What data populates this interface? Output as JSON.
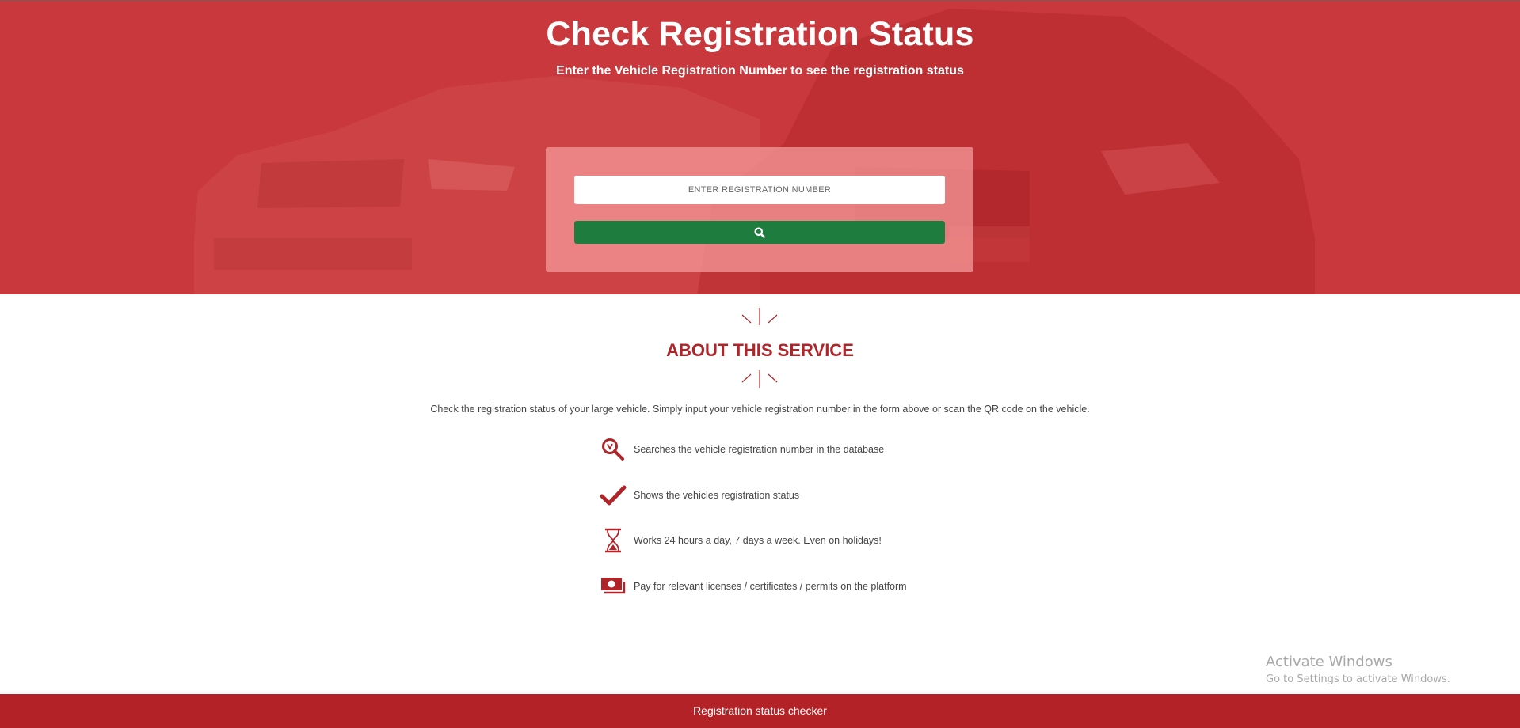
{
  "hero": {
    "title": "Check Registration Status",
    "subtitle": "Enter the Vehicle Registration Number to see the registration status"
  },
  "search": {
    "placeholder": "ENTER REGISTRATION NUMBER",
    "button_icon": "search-icon"
  },
  "about": {
    "heading": "ABOUT THIS SERVICE",
    "description": "Check the registration status of your large vehicle. Simply input your vehicle registration number in the form above or scan the QR code on the vehicle.",
    "features": [
      {
        "icon": "search-database-icon",
        "text": "Searches the vehicle registration number in the database"
      },
      {
        "icon": "checkmark-icon",
        "text": "Shows the vehicles registration status"
      },
      {
        "icon": "hourglass-icon",
        "text": "Works 24 hours a day, 7 days a week. Even on holidays!"
      },
      {
        "icon": "money-icon",
        "text": "Pay for relevant licenses / certificates / permits on the platform"
      }
    ]
  },
  "watermark": {
    "title": "Activate Windows",
    "subtitle": "Go to Settings to activate Windows."
  },
  "footer": {
    "text": "Registration status checker"
  },
  "colors": {
    "hero_red": "#c8383c",
    "accent_red": "#b0252a",
    "button_green": "#1e7d3e",
    "footer_red": "#b32226"
  }
}
